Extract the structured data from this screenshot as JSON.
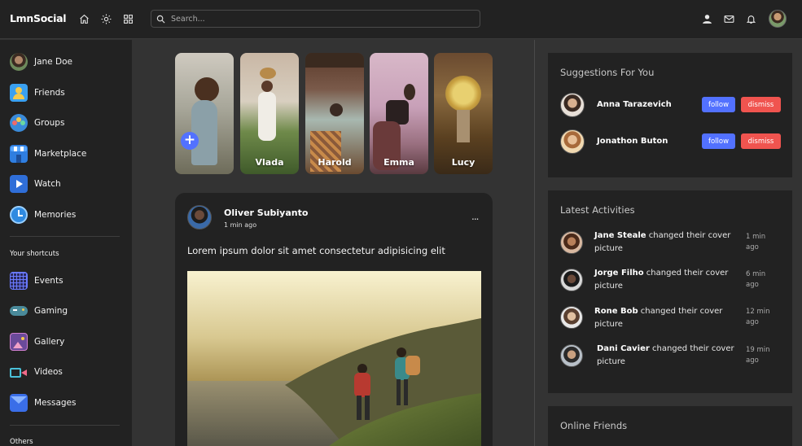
{
  "navbar": {
    "logo": "LmnSocial",
    "icons": [
      "home-icon",
      "sun-icon",
      "grid-icon",
      "user-icon",
      "mail-icon",
      "bell-icon"
    ],
    "search_placeholder": "Search..."
  },
  "sidebar": {
    "items": [
      {
        "label": "Jane Doe"
      },
      {
        "label": "Friends"
      },
      {
        "label": "Groups"
      },
      {
        "label": "Marketplace"
      },
      {
        "label": "Watch"
      },
      {
        "label": "Memories"
      }
    ],
    "shortcuts_heading": "Your shortcuts",
    "shortcuts": [
      {
        "label": "Events"
      },
      {
        "label": "Gaming"
      },
      {
        "label": "Gallery"
      },
      {
        "label": "Videos"
      },
      {
        "label": "Messages"
      }
    ],
    "others_heading": "Others"
  },
  "stories": [
    {
      "name": ""
    },
    {
      "name": "Vlada"
    },
    {
      "name": "Harold"
    },
    {
      "name": "Emma"
    },
    {
      "name": "Lucy"
    }
  ],
  "post": {
    "author": "Oliver Subiyanto",
    "time": "1 min ago",
    "more": "...",
    "text": "Lorem ipsum dolor sit amet consectetur adipisicing elit"
  },
  "suggestions": {
    "title": "Suggestions For You",
    "follow_label": "follow",
    "dismiss_label": "dismiss",
    "people": [
      {
        "name": "Anna Tarazevich"
      },
      {
        "name": "Jonathon Buton"
      }
    ]
  },
  "activities": {
    "title": "Latest Activities",
    "items": [
      {
        "name": "Jane Steale",
        "action": " changed their cover picture",
        "time": "1 min ago"
      },
      {
        "name": "Jorge Filho",
        "action": " changed their cover picture",
        "time": "6 min ago"
      },
      {
        "name": "Rone Bob",
        "action": " changed their cover picture",
        "time": "12 min ago"
      },
      {
        "name": "Dani Cavier",
        "action": " changed their cover picture",
        "time": "19 min ago"
      }
    ]
  },
  "online": {
    "title": "Online Friends"
  },
  "colors": {
    "accent": "#5271ff",
    "danger": "#f0544f",
    "background": "#333333",
    "panel": "#222222"
  }
}
